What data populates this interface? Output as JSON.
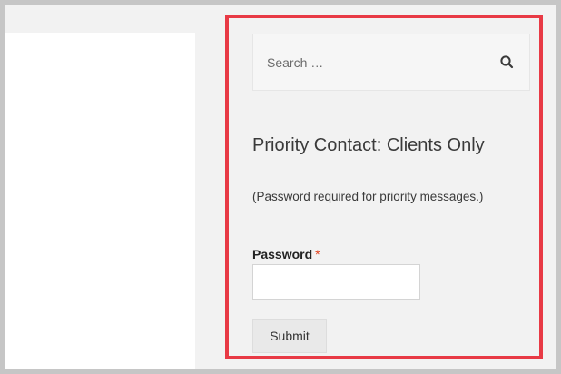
{
  "search": {
    "placeholder": "Search …",
    "icon": "search-icon"
  },
  "widget": {
    "title": "Priority Contact: Clients Only",
    "note": "(Password required for priority messages.)"
  },
  "form": {
    "password_label": "Password",
    "required_mark": "*",
    "password_value": "",
    "submit_label": "Submit"
  },
  "colors": {
    "highlight_border": "#e83a45",
    "required": "#e2401c",
    "sidebar_background": "#f2f2f2",
    "frame": "#c6c6c6"
  }
}
